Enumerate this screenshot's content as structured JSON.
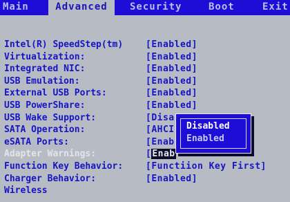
{
  "menu": {
    "tabs": [
      {
        "label": "Main"
      },
      {
        "label": "Advanced"
      },
      {
        "label": "Security"
      },
      {
        "label": "Boot"
      },
      {
        "label": "Exit"
      }
    ]
  },
  "settings": [
    {
      "label": "Intel(R) SpeedStep(tm)",
      "value": "[Enabled]"
    },
    {
      "label": "Virtualization:",
      "value": "[Enabled]"
    },
    {
      "label": "Integrated NIC:",
      "value": "[Enabled]"
    },
    {
      "label": "USB Emulation:",
      "value": "[Enabled]"
    },
    {
      "label": "External USB Ports:",
      "value": "[Enabled]"
    },
    {
      "label": "USB PowerShare:",
      "value": "[Enabled]"
    },
    {
      "label": "USB Wake Support:",
      "value": "[Disa"
    },
    {
      "label": "SATA Operation:",
      "value": "[AHCI"
    },
    {
      "label": "eSATA Ports:",
      "value": "[Enab"
    },
    {
      "label": "Adapter Warnings:",
      "value_cursor": "[",
      "value": "Enab"
    },
    {
      "label": "Function Key Behavior:",
      "value": "[Functi",
      "value_tail": "ion Key First]"
    },
    {
      "label": "Charger Behavior:",
      "value": "[Enabled]"
    },
    {
      "label": "Wireless",
      "value": ""
    }
  ],
  "popup": {
    "options": [
      {
        "label": "Disabled",
        "color": "#ffffff"
      },
      {
        "label": "Enabled",
        "color": "#c6ccf2"
      }
    ]
  },
  "colors": {
    "menubar": "#1d0dd6",
    "background": "#b7bcc4",
    "text": "#1614c4",
    "dim_text": "#e2e5ea"
  }
}
